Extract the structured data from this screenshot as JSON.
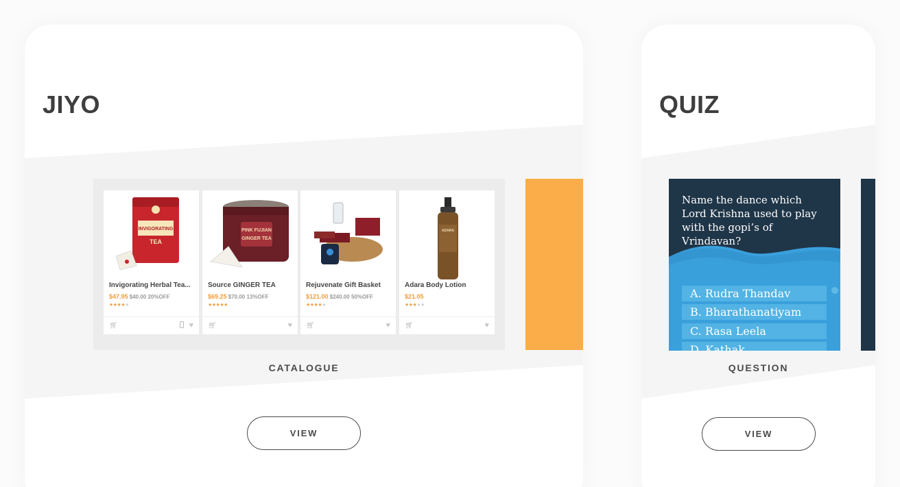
{
  "cards": {
    "jiyo": {
      "title": "JIYO",
      "caption": "CATALOGUE",
      "view_label": "VIEW",
      "products": [
        {
          "name": "Invigorating Herbal Tea...",
          "price": "$47.95",
          "old_price": "$40.00",
          "discount": "20%OFF",
          "rating": 4
        },
        {
          "name": "Source GINGER TEA",
          "price": "$69.25",
          "old_price": "$70.00",
          "discount": "13%OFF",
          "rating": 5
        },
        {
          "name": "Rejuvenate Gift Basket",
          "price": "$121.00",
          "old_price": "$240.00",
          "discount": "50%OFF",
          "rating": 4
        },
        {
          "name": "Adara Body Lotion",
          "price": "$21.05",
          "old_price": "",
          "discount": "",
          "rating": 3
        }
      ]
    },
    "quiz": {
      "title": "QUIZ",
      "caption": "QUESTION",
      "view_label": "VIEW",
      "question": "Name the dance which Lord Krishna used to play with the gopi’s of Vrindavan?",
      "options": [
        "A. Rudra Thandav",
        "B. Bharathanatiyam",
        "C. Rasa Leela",
        "D. Kathak"
      ]
    }
  },
  "colors": {
    "accent_orange": "#fbad4a",
    "quiz_navy": "#1f3548",
    "quiz_blue": "#3aa0dc",
    "price_orange": "#f19c3a"
  },
  "icons": [
    "cart-icon",
    "heart-icon",
    "phone-icon",
    "star-icon"
  ]
}
